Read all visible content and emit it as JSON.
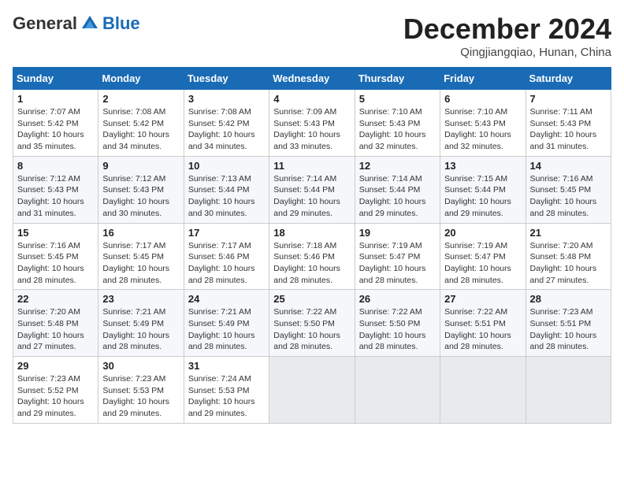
{
  "header": {
    "logo": {
      "general": "General",
      "blue": "Blue"
    },
    "title": "December 2024",
    "location": "Qingjiangqiao, Hunan, China"
  },
  "calendar": {
    "days_of_week": [
      "Sunday",
      "Monday",
      "Tuesday",
      "Wednesday",
      "Thursday",
      "Friday",
      "Saturday"
    ],
    "weeks": [
      [
        null,
        null,
        null,
        null,
        null,
        null,
        null
      ]
    ]
  },
  "cells": [
    {
      "day": "1",
      "sunrise": "7:07 AM",
      "sunset": "5:42 PM",
      "daylight": "10 hours and 35 minutes."
    },
    {
      "day": "2",
      "sunrise": "7:08 AM",
      "sunset": "5:42 PM",
      "daylight": "10 hours and 34 minutes."
    },
    {
      "day": "3",
      "sunrise": "7:08 AM",
      "sunset": "5:42 PM",
      "daylight": "10 hours and 34 minutes."
    },
    {
      "day": "4",
      "sunrise": "7:09 AM",
      "sunset": "5:43 PM",
      "daylight": "10 hours and 33 minutes."
    },
    {
      "day": "5",
      "sunrise": "7:10 AM",
      "sunset": "5:43 PM",
      "daylight": "10 hours and 32 minutes."
    },
    {
      "day": "6",
      "sunrise": "7:10 AM",
      "sunset": "5:43 PM",
      "daylight": "10 hours and 32 minutes."
    },
    {
      "day": "7",
      "sunrise": "7:11 AM",
      "sunset": "5:43 PM",
      "daylight": "10 hours and 31 minutes."
    },
    {
      "day": "8",
      "sunrise": "7:12 AM",
      "sunset": "5:43 PM",
      "daylight": "10 hours and 31 minutes."
    },
    {
      "day": "9",
      "sunrise": "7:12 AM",
      "sunset": "5:43 PM",
      "daylight": "10 hours and 30 minutes."
    },
    {
      "day": "10",
      "sunrise": "7:13 AM",
      "sunset": "5:44 PM",
      "daylight": "10 hours and 30 minutes."
    },
    {
      "day": "11",
      "sunrise": "7:14 AM",
      "sunset": "5:44 PM",
      "daylight": "10 hours and 29 minutes."
    },
    {
      "day": "12",
      "sunrise": "7:14 AM",
      "sunset": "5:44 PM",
      "daylight": "10 hours and 29 minutes."
    },
    {
      "day": "13",
      "sunrise": "7:15 AM",
      "sunset": "5:44 PM",
      "daylight": "10 hours and 29 minutes."
    },
    {
      "day": "14",
      "sunrise": "7:16 AM",
      "sunset": "5:45 PM",
      "daylight": "10 hours and 28 minutes."
    },
    {
      "day": "15",
      "sunrise": "7:16 AM",
      "sunset": "5:45 PM",
      "daylight": "10 hours and 28 minutes."
    },
    {
      "day": "16",
      "sunrise": "7:17 AM",
      "sunset": "5:45 PM",
      "daylight": "10 hours and 28 minutes."
    },
    {
      "day": "17",
      "sunrise": "7:17 AM",
      "sunset": "5:46 PM",
      "daylight": "10 hours and 28 minutes."
    },
    {
      "day": "18",
      "sunrise": "7:18 AM",
      "sunset": "5:46 PM",
      "daylight": "10 hours and 28 minutes."
    },
    {
      "day": "19",
      "sunrise": "7:19 AM",
      "sunset": "5:47 PM",
      "daylight": "10 hours and 28 minutes."
    },
    {
      "day": "20",
      "sunrise": "7:19 AM",
      "sunset": "5:47 PM",
      "daylight": "10 hours and 28 minutes."
    },
    {
      "day": "21",
      "sunrise": "7:20 AM",
      "sunset": "5:48 PM",
      "daylight": "10 hours and 27 minutes."
    },
    {
      "day": "22",
      "sunrise": "7:20 AM",
      "sunset": "5:48 PM",
      "daylight": "10 hours and 27 minutes."
    },
    {
      "day": "23",
      "sunrise": "7:21 AM",
      "sunset": "5:49 PM",
      "daylight": "10 hours and 28 minutes."
    },
    {
      "day": "24",
      "sunrise": "7:21 AM",
      "sunset": "5:49 PM",
      "daylight": "10 hours and 28 minutes."
    },
    {
      "day": "25",
      "sunrise": "7:22 AM",
      "sunset": "5:50 PM",
      "daylight": "10 hours and 28 minutes."
    },
    {
      "day": "26",
      "sunrise": "7:22 AM",
      "sunset": "5:50 PM",
      "daylight": "10 hours and 28 minutes."
    },
    {
      "day": "27",
      "sunrise": "7:22 AM",
      "sunset": "5:51 PM",
      "daylight": "10 hours and 28 minutes."
    },
    {
      "day": "28",
      "sunrise": "7:23 AM",
      "sunset": "5:51 PM",
      "daylight": "10 hours and 28 minutes."
    },
    {
      "day": "29",
      "sunrise": "7:23 AM",
      "sunset": "5:52 PM",
      "daylight": "10 hours and 29 minutes."
    },
    {
      "day": "30",
      "sunrise": "7:23 AM",
      "sunset": "5:53 PM",
      "daylight": "10 hours and 29 minutes."
    },
    {
      "day": "31",
      "sunrise": "7:24 AM",
      "sunset": "5:53 PM",
      "daylight": "10 hours and 29 minutes."
    }
  ]
}
